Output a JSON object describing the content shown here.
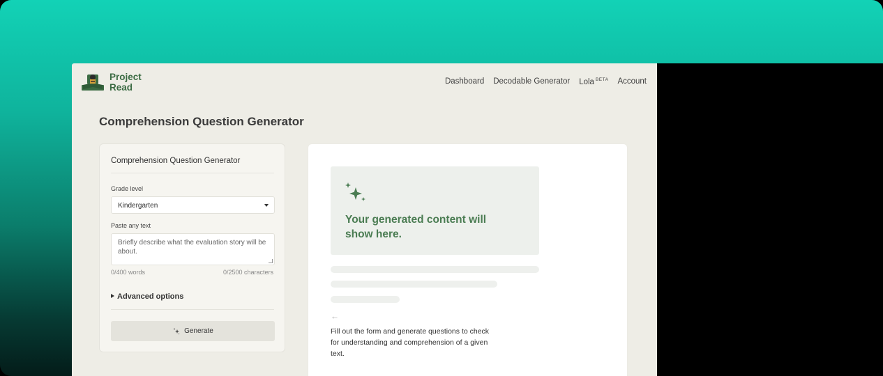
{
  "brand": {
    "line1": "Project",
    "line2": "Read"
  },
  "nav": {
    "dashboard": "Dashboard",
    "decodable": "Decodable Generator",
    "lola": "Lola",
    "lola_badge": "BETA",
    "account": "Account"
  },
  "page_title": "Comprehension Question Generator",
  "form": {
    "title": "Comprehension Question Generator",
    "grade_label": "Grade level",
    "grade_value": "Kindergarten",
    "text_label": "Paste any text",
    "text_placeholder": "Briefly describe what the evaluation story will be about.",
    "word_count": "0/400 words",
    "char_count": "0/2500 characters",
    "advanced": "Advanced options",
    "generate": "Generate"
  },
  "output": {
    "placeholder": "Your generated content will show here.",
    "arrow": "←",
    "hint": "Fill out the form and generate questions to check for understanding and comprehension of a given text."
  },
  "colors": {
    "accent_green": "#4a7c52",
    "app_bg": "#eeede6",
    "gradient_top": "#12d2b6"
  }
}
